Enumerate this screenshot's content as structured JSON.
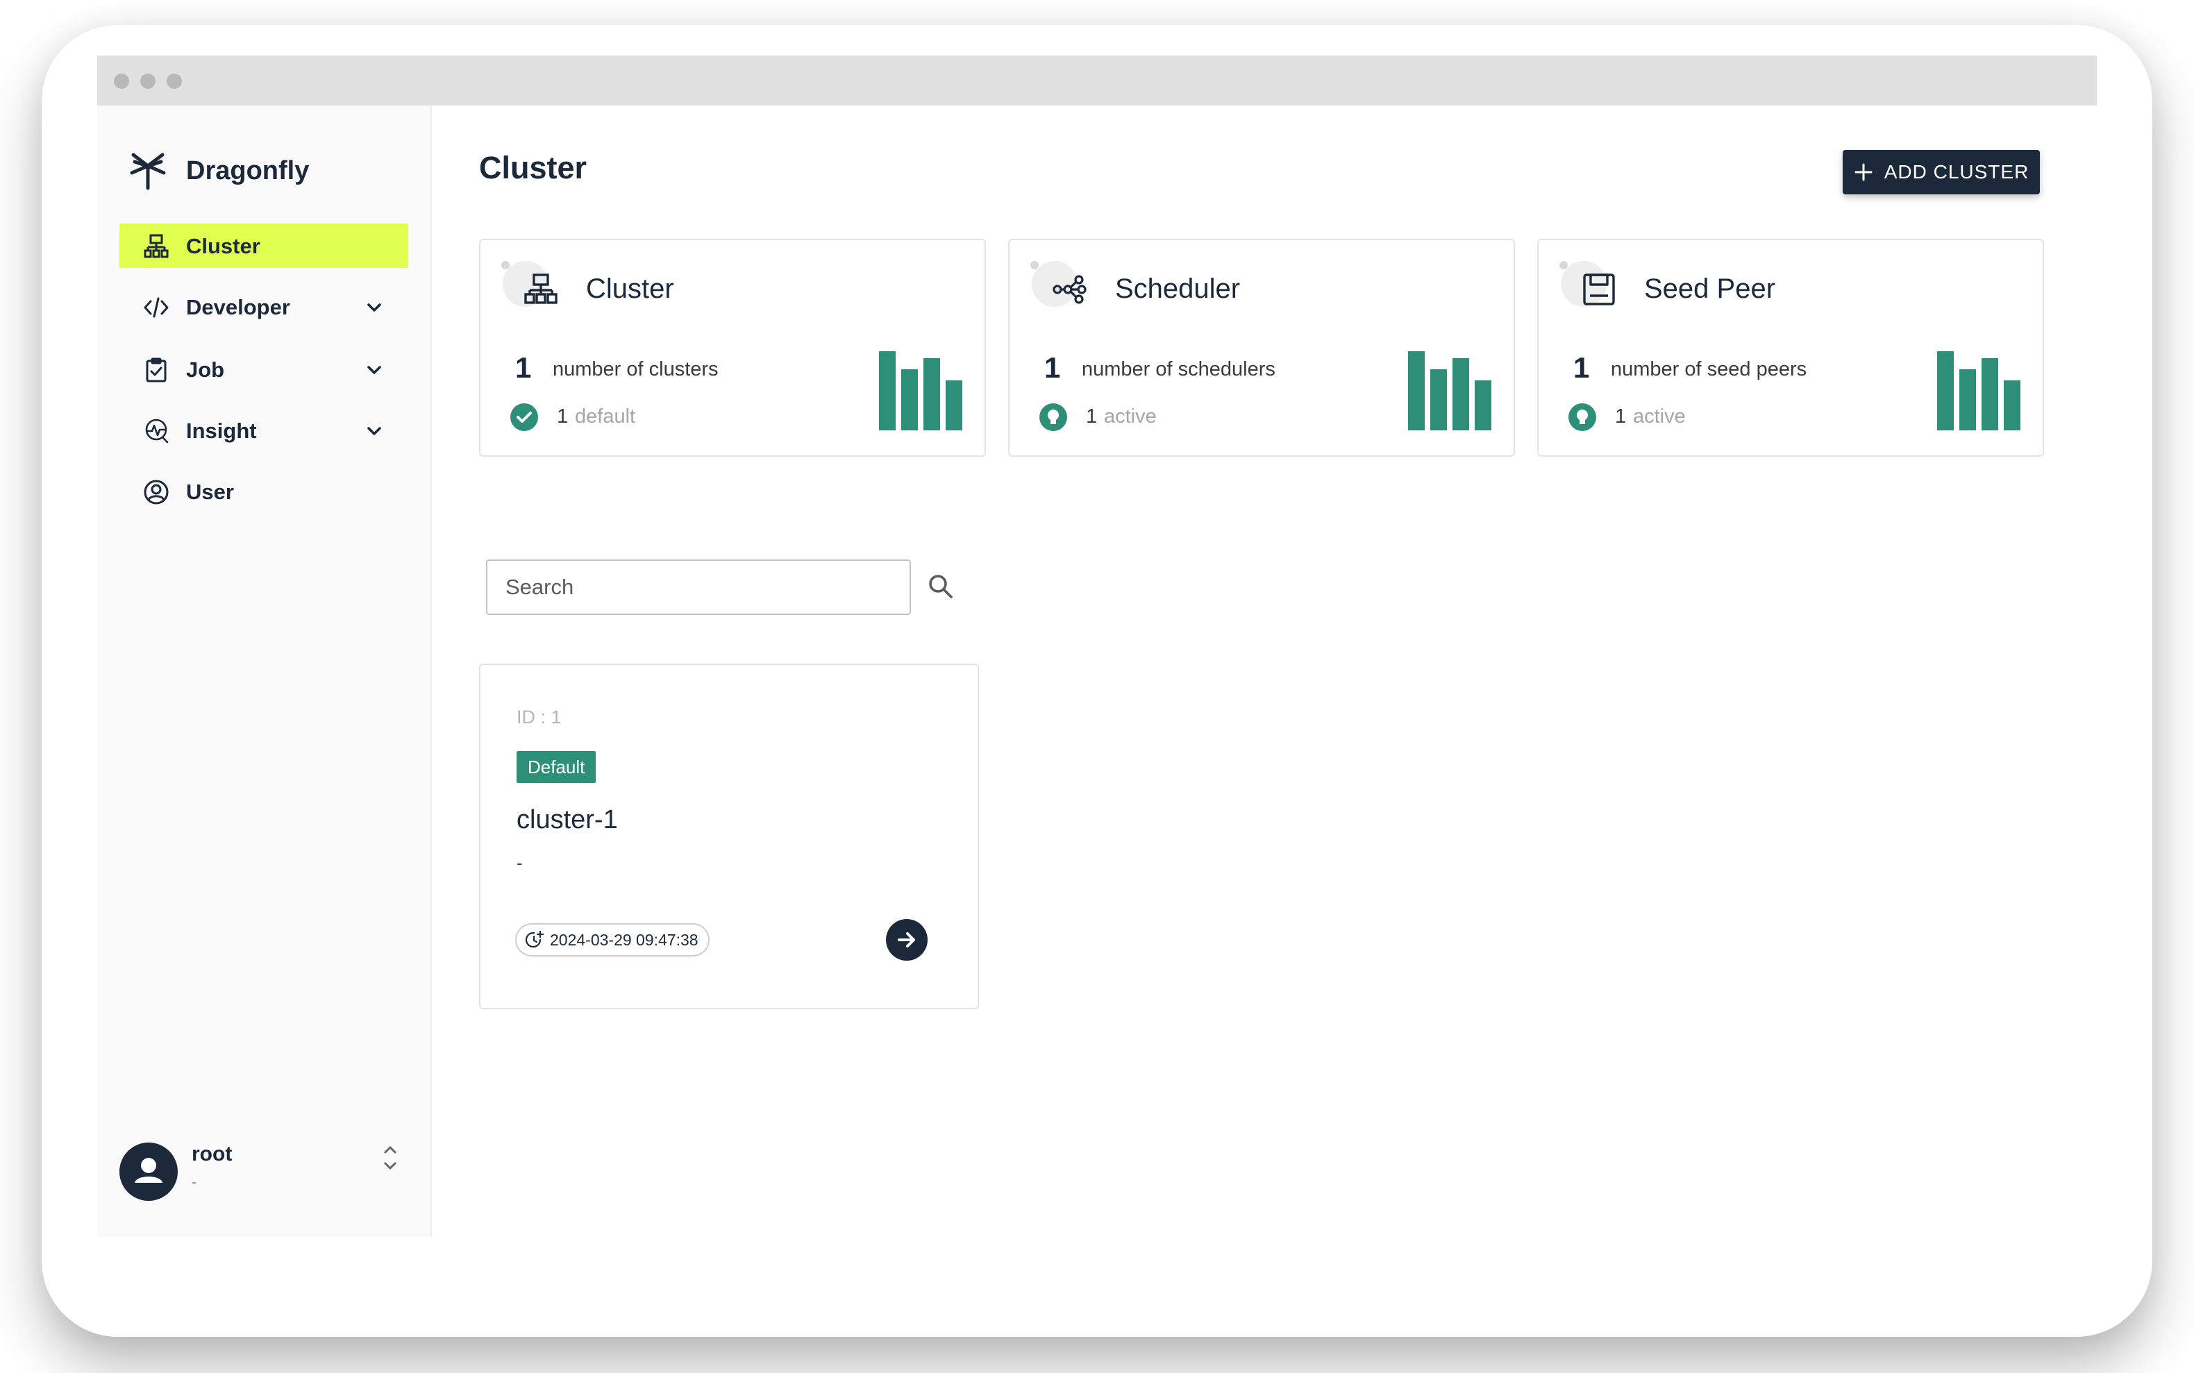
{
  "sidebar": {
    "brand": "Dragonfly",
    "items": [
      {
        "label": "Cluster",
        "icon": "cluster-icon",
        "active": true
      },
      {
        "label": "Developer",
        "icon": "code-icon",
        "expandable": true
      },
      {
        "label": "Job",
        "icon": "clipboard-check-icon",
        "expandable": true
      },
      {
        "label": "Insight",
        "icon": "insight-icon",
        "expandable": true
      },
      {
        "label": "User",
        "icon": "user-circle-icon"
      }
    ],
    "user": {
      "name": "root",
      "subtitle": "-"
    }
  },
  "main": {
    "title": "Cluster",
    "add_button": "ADD CLUSTER",
    "stats": [
      {
        "title": "Cluster",
        "count": "1",
        "count_label": "number of clusters",
        "status_count": "1",
        "status_label": "default",
        "icon": "cluster-icon",
        "status_icon": "check-circle-icon"
      },
      {
        "title": "Scheduler",
        "count": "1",
        "count_label": "number of schedulers",
        "status_count": "1",
        "status_label": "active",
        "icon": "scheduler-icon",
        "status_icon": "lightbulb-icon"
      },
      {
        "title": "Seed Peer",
        "count": "1",
        "count_label": "number of seed peers",
        "status_count": "1",
        "status_label": "active",
        "icon": "seed-peer-icon",
        "status_icon": "lightbulb-icon"
      }
    ],
    "search": {
      "placeholder": "Search",
      "value": ""
    },
    "clusters": [
      {
        "id_text": "ID : 1",
        "badge": "Default",
        "name": "cluster-1",
        "description": "-",
        "created_at": "2024-03-29 09:47:38"
      }
    ]
  },
  "colors": {
    "primary": "#1c293a",
    "accent": "#e0ff4f",
    "success": "#2e8f79"
  }
}
